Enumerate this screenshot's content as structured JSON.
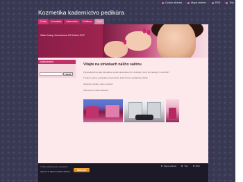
{
  "topnav": {
    "links": [
      "Úvodní stránka",
      "Mapa stránek",
      "RSS",
      "Tisk"
    ]
  },
  "site": {
    "title": "Kozmetika kaderníctvo pedikúra"
  },
  "tabs": [
    "O nás",
    "Kozmetika",
    "Kaderníctvo",
    "Pedikúra",
    "Ceník"
  ],
  "banner": {
    "address": "Salón krásy, Hemerkova 23 Košice KVP"
  },
  "sidebar": {
    "heading": "Vyhľadávanie",
    "search_placeholder": "",
    "search_button": "Hľadať"
  },
  "main": {
    "heading": "Vitajte na stránkach nášho salónu",
    "paragraphs": [
      "Prezentácia firmy ako náš salónu na ulici Hemerkova 23 v Košiciach, ktorý bol založený v roku 2007.",
      "V našom salóne poskytujeme kozmetické, kaderníctve a pedikérske služby.",
      "Navštívte si krásu, relax a rodnosť.",
      "Tešíme sa na Vašu návštevu!"
    ]
  },
  "footer": {
    "copyright": "© 2011 Všetky práva vyhradené.",
    "create_text": "Vytvorte si vlastnú stránku zdarma",
    "create_button": "Webnode",
    "links": [
      "Mapa stránek",
      "Tisk",
      "RSS"
    ]
  },
  "colors": {
    "accent": "#d3336f",
    "background": "#3a3954",
    "content": "#fde8ec"
  }
}
